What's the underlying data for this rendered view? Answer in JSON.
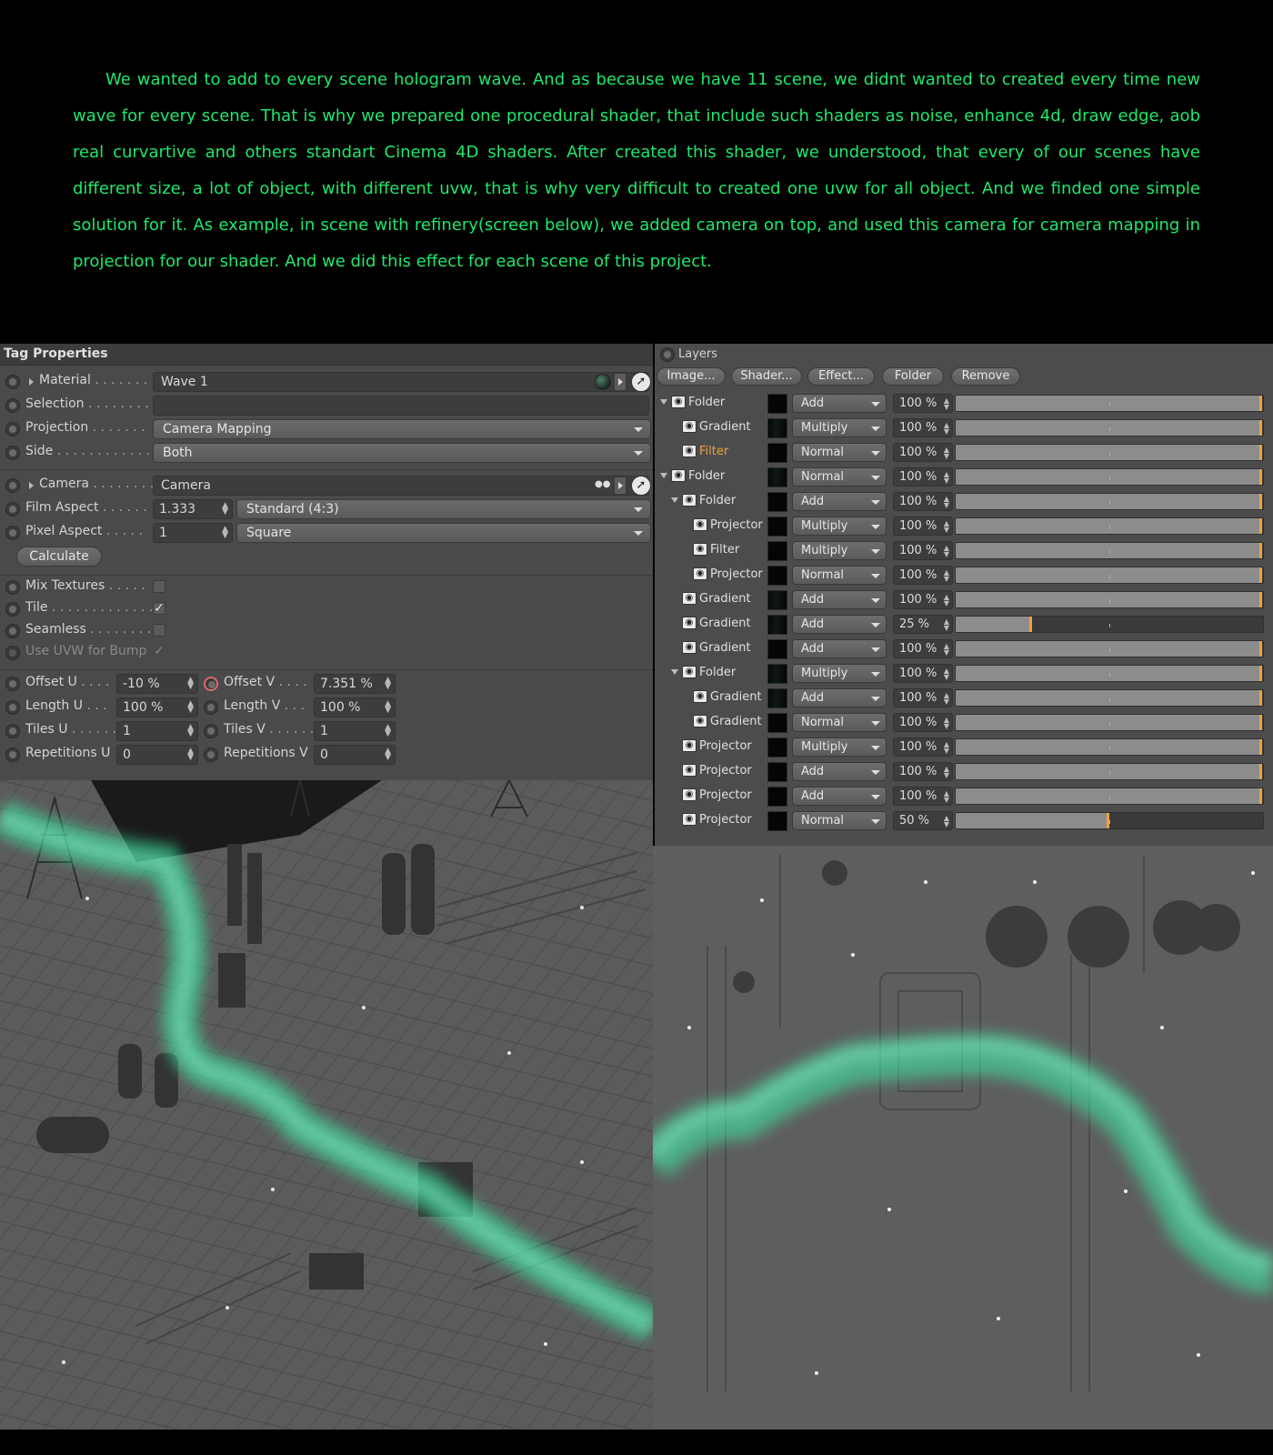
{
  "intro_text": "We wanted to add to every scene hologram wave. And as because we have 11 scene, we didnt wanted to created every time new wave for every scene. That is why we prepared one procedural shader, that include such shaders as noise, enhance 4d, draw edge, aob real curvartive and others standart Cinema 4D shaders. After created this shader, we understood, that every of our scenes have different size, a lot of object, with different uvw, that is why very difficult to created one uvw for all object. And we finded one simple solution for it. As example, in scene with refinery(screen below), we added camera on top, and used this camera for camera mapping in projection for our shader. And we did this effect for each scene of this project.",
  "tag_properties": {
    "title": "Tag Properties",
    "material": {
      "label": "Material",
      "dots": " . . . . . . .",
      "value": "Wave 1"
    },
    "selection": {
      "label": "Selection",
      "dots": " . . . . . . . .",
      "value": ""
    },
    "projection": {
      "label": "Projection",
      "dots": " . . . . . . .",
      "value": "Camera Mapping"
    },
    "side": {
      "label": "Side",
      "dots": " . . . . . . . . . . . .",
      "value": "Both"
    },
    "camera": {
      "label": "Camera",
      "dots": " . . . . . . . .",
      "value": "Camera"
    },
    "film_aspect": {
      "label": "Film Aspect",
      "dots": " . . . . . .",
      "value": "1.333",
      "preset": "Standard (4:3)"
    },
    "pixel_aspect": {
      "label": "Pixel Aspect",
      "dots": " . . . . .",
      "value": "1",
      "preset": "Square"
    },
    "calculate_label": "Calculate",
    "mix_textures": {
      "label": "Mix Textures",
      "dots": " . . . . .",
      "checked": false
    },
    "tile": {
      "label": "Tile",
      "dots": " . . . . . . . . . . . . . .",
      "checked": true,
      "mark": "✓"
    },
    "seamless": {
      "label": "Seamless",
      "dots": " . . . . . . . .",
      "checked": false
    },
    "use_uvw_bump": {
      "label": "Use UVW for Bump",
      "checked": true,
      "mark": "✓"
    },
    "offset_u": {
      "label": "Offset U",
      "dots": " . . . .",
      "value": "-10 %"
    },
    "offset_v": {
      "label": "Offset V",
      "dots": " . . . .",
      "value": "7.351 %"
    },
    "length_u": {
      "label": "Length U",
      "dots": " . . .",
      "value": "100 %"
    },
    "length_v": {
      "label": "Length V",
      "dots": " . . .",
      "value": "100 %"
    },
    "tiles_u": {
      "label": "Tiles U",
      "dots": " . . . . . .",
      "value": "1"
    },
    "tiles_v": {
      "label": "Tiles V",
      "dots": " . . . . . .",
      "value": "1"
    },
    "repetitions_u": {
      "label": "Repetitions U",
      "value": "0"
    },
    "repetitions_v": {
      "label": "Repetitions V",
      "value": "0"
    }
  },
  "layers_panel": {
    "title": "Layers",
    "buttons": [
      "Image...",
      "Shader...",
      "Effect...",
      "Folder",
      "Remove"
    ],
    "rows": [
      {
        "name": "Folder",
        "indent": 0,
        "expand": true,
        "thumb": "black",
        "blend": "Add",
        "opacity": "100 %",
        "level": 1.0
      },
      {
        "name": "Gradient",
        "indent": 1,
        "expand": false,
        "thumb": "gradient",
        "blend": "Multiply",
        "opacity": "100 %",
        "level": 1.0
      },
      {
        "name": "Filter",
        "indent": 1,
        "expand": false,
        "thumb": "black",
        "blend": "Normal",
        "opacity": "100 %",
        "level": 1.0,
        "highlight": true
      },
      {
        "name": "Folder",
        "indent": 0,
        "expand": true,
        "thumb": "gradient",
        "blend": "Normal",
        "opacity": "100 %",
        "level": 1.0
      },
      {
        "name": "Folder",
        "indent": 1,
        "expand": true,
        "thumb": "black",
        "blend": "Add",
        "opacity": "100 %",
        "level": 1.0
      },
      {
        "name": "Projector",
        "indent": 2,
        "expand": false,
        "thumb": "black",
        "blend": "Multiply",
        "opacity": "100 %",
        "level": 1.0
      },
      {
        "name": "Filter",
        "indent": 2,
        "expand": false,
        "thumb": "black",
        "blend": "Multiply",
        "opacity": "100 %",
        "level": 1.0
      },
      {
        "name": "Projector",
        "indent": 2,
        "expand": false,
        "thumb": "black",
        "blend": "Normal",
        "opacity": "100 %",
        "level": 1.0
      },
      {
        "name": "Gradient",
        "indent": 1,
        "expand": false,
        "thumb": "gradient",
        "blend": "Add",
        "opacity": "100 %",
        "level": 1.0
      },
      {
        "name": "Gradient",
        "indent": 1,
        "expand": false,
        "thumb": "gradient",
        "blend": "Add",
        "opacity": "25 %",
        "level": 0.25
      },
      {
        "name": "Gradient",
        "indent": 1,
        "expand": false,
        "thumb": "black",
        "blend": "Add",
        "opacity": "100 %",
        "level": 1.0
      },
      {
        "name": "Folder",
        "indent": 1,
        "expand": true,
        "thumb": "gradient",
        "blend": "Multiply",
        "opacity": "100 %",
        "level": 1.0
      },
      {
        "name": "Gradient",
        "indent": 2,
        "expand": false,
        "thumb": "gradient",
        "blend": "Add",
        "opacity": "100 %",
        "level": 1.0
      },
      {
        "name": "Gradient",
        "indent": 2,
        "expand": false,
        "thumb": "black",
        "blend": "Normal",
        "opacity": "100 %",
        "level": 1.0
      },
      {
        "name": "Projector",
        "indent": 1,
        "expand": false,
        "thumb": "black",
        "blend": "Multiply",
        "opacity": "100 %",
        "level": 1.0
      },
      {
        "name": "Projector",
        "indent": 1,
        "expand": false,
        "thumb": "black",
        "blend": "Add",
        "opacity": "100 %",
        "level": 1.0
      },
      {
        "name": "Projector",
        "indent": 1,
        "expand": false,
        "thumb": "black",
        "blend": "Add",
        "opacity": "100 %",
        "level": 1.0
      },
      {
        "name": "Projector",
        "indent": 1,
        "expand": false,
        "thumb": "black",
        "blend": "Normal",
        "opacity": "50 %",
        "level": 0.5
      }
    ]
  },
  "colors": {
    "accent_text": "#1fe86c",
    "hologram": "#3cf0a8",
    "orange_highlight": "#f0a23a"
  },
  "icons": {
    "eye": "eye-icon",
    "radio": "animation-radio-icon",
    "cursor": "pick-cursor-icon",
    "material": "material-ball-icon"
  }
}
